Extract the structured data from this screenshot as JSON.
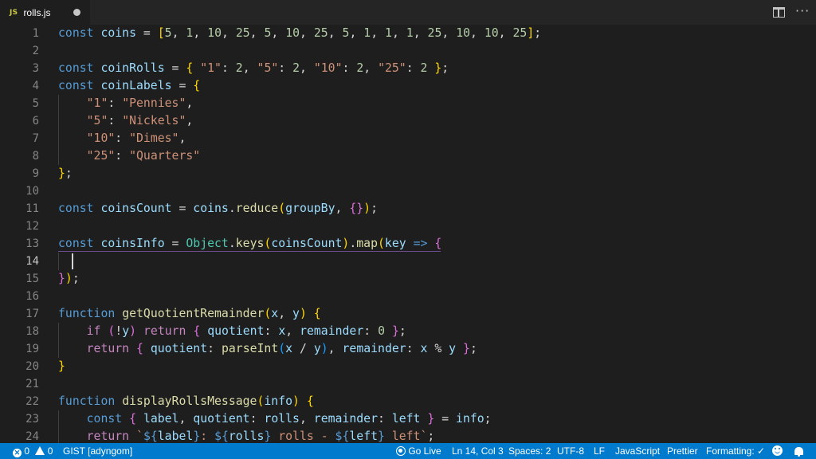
{
  "tab": {
    "icon": "JS",
    "filename": "rolls.js"
  },
  "code_lines": [
    [
      [
        "k",
        "const "
      ],
      [
        "v",
        "coins"
      ],
      [
        "o",
        " = "
      ],
      [
        "b1",
        "["
      ],
      [
        "n",
        "5"
      ],
      [
        "o",
        ", "
      ],
      [
        "n",
        "1"
      ],
      [
        "o",
        ", "
      ],
      [
        "n",
        "10"
      ],
      [
        "o",
        ", "
      ],
      [
        "n",
        "25"
      ],
      [
        "o",
        ", "
      ],
      [
        "n",
        "5"
      ],
      [
        "o",
        ", "
      ],
      [
        "n",
        "10"
      ],
      [
        "o",
        ", "
      ],
      [
        "n",
        "25"
      ],
      [
        "o",
        ", "
      ],
      [
        "n",
        "5"
      ],
      [
        "o",
        ", "
      ],
      [
        "n",
        "1"
      ],
      [
        "o",
        ", "
      ],
      [
        "n",
        "1"
      ],
      [
        "o",
        ", "
      ],
      [
        "n",
        "1"
      ],
      [
        "o",
        ", "
      ],
      [
        "n",
        "25"
      ],
      [
        "o",
        ", "
      ],
      [
        "n",
        "10"
      ],
      [
        "o",
        ", "
      ],
      [
        "n",
        "10"
      ],
      [
        "o",
        ", "
      ],
      [
        "n",
        "25"
      ],
      [
        "b1",
        "]"
      ],
      [
        "o",
        ";"
      ]
    ],
    [],
    [
      [
        "k",
        "const "
      ],
      [
        "v",
        "coinRolls"
      ],
      [
        "o",
        " = "
      ],
      [
        "b1",
        "{"
      ],
      [
        "o",
        " "
      ],
      [
        "s",
        "\"1\""
      ],
      [
        "o",
        ": "
      ],
      [
        "n",
        "2"
      ],
      [
        "o",
        ", "
      ],
      [
        "s",
        "\"5\""
      ],
      [
        "o",
        ": "
      ],
      [
        "n",
        "2"
      ],
      [
        "o",
        ", "
      ],
      [
        "s",
        "\"10\""
      ],
      [
        "o",
        ": "
      ],
      [
        "n",
        "2"
      ],
      [
        "o",
        ", "
      ],
      [
        "s",
        "\"25\""
      ],
      [
        "o",
        ": "
      ],
      [
        "n",
        "2"
      ],
      [
        "o",
        " "
      ],
      [
        "b1",
        "}"
      ],
      [
        "o",
        ";"
      ]
    ],
    [
      [
        "k",
        "const "
      ],
      [
        "v",
        "coinLabels"
      ],
      [
        "o",
        " = "
      ],
      [
        "b1",
        "{"
      ]
    ],
    [
      [
        "o",
        "    "
      ],
      [
        "s",
        "\"1\""
      ],
      [
        "o",
        ": "
      ],
      [
        "s",
        "\"Pennies\""
      ],
      [
        "o",
        ","
      ]
    ],
    [
      [
        "o",
        "    "
      ],
      [
        "s",
        "\"5\""
      ],
      [
        "o",
        ": "
      ],
      [
        "s",
        "\"Nickels\""
      ],
      [
        "o",
        ","
      ]
    ],
    [
      [
        "o",
        "    "
      ],
      [
        "s",
        "\"10\""
      ],
      [
        "o",
        ": "
      ],
      [
        "s",
        "\"Dimes\""
      ],
      [
        "o",
        ","
      ]
    ],
    [
      [
        "o",
        "    "
      ],
      [
        "s",
        "\"25\""
      ],
      [
        "o",
        ": "
      ],
      [
        "s",
        "\"Quarters\""
      ]
    ],
    [
      [
        "b1",
        "}"
      ],
      [
        "o",
        ";"
      ]
    ],
    [],
    [
      [
        "k",
        "const "
      ],
      [
        "v",
        "coinsCount"
      ],
      [
        "o",
        " = "
      ],
      [
        "v",
        "coins"
      ],
      [
        "o",
        "."
      ],
      [
        "f",
        "reduce"
      ],
      [
        "b1",
        "("
      ],
      [
        "v",
        "groupBy"
      ],
      [
        "o",
        ", "
      ],
      [
        "b2",
        "{}"
      ],
      [
        "b1",
        ")"
      ],
      [
        "o",
        ";"
      ]
    ],
    [],
    [
      [
        "k",
        "const "
      ],
      [
        "v",
        "coinsInfo"
      ],
      [
        "o",
        " = "
      ],
      [
        "c",
        "Object"
      ],
      [
        "o",
        "."
      ],
      [
        "f",
        "keys"
      ],
      [
        "b1",
        "("
      ],
      [
        "v",
        "coinsCount"
      ],
      [
        "b1",
        ")"
      ],
      [
        "o",
        "."
      ],
      [
        "f",
        "map"
      ],
      [
        "b1",
        "("
      ],
      [
        "v",
        "key"
      ],
      [
        "o",
        " "
      ],
      [
        "k",
        "=>"
      ],
      [
        "o",
        " "
      ],
      [
        "b2",
        "{"
      ]
    ],
    [],
    [
      [
        "b2",
        "}"
      ],
      [
        "b1",
        ")"
      ],
      [
        "o",
        ";"
      ]
    ],
    [],
    [
      [
        "k",
        "function "
      ],
      [
        "f",
        "getQuotientRemainder"
      ],
      [
        "b1",
        "("
      ],
      [
        "v",
        "x"
      ],
      [
        "o",
        ", "
      ],
      [
        "v",
        "y"
      ],
      [
        "b1",
        ")"
      ],
      [
        "o",
        " "
      ],
      [
        "b1",
        "{"
      ]
    ],
    [
      [
        "o",
        "    "
      ],
      [
        "p",
        "if"
      ],
      [
        "o",
        " "
      ],
      [
        "b2",
        "("
      ],
      [
        "o",
        "!"
      ],
      [
        "v",
        "y"
      ],
      [
        "b2",
        ")"
      ],
      [
        "o",
        " "
      ],
      [
        "p",
        "return"
      ],
      [
        "o",
        " "
      ],
      [
        "b2",
        "{"
      ],
      [
        "o",
        " "
      ],
      [
        "v",
        "quotient"
      ],
      [
        "o",
        ": "
      ],
      [
        "v",
        "x"
      ],
      [
        "o",
        ", "
      ],
      [
        "v",
        "remainder"
      ],
      [
        "o",
        ": "
      ],
      [
        "n",
        "0"
      ],
      [
        "o",
        " "
      ],
      [
        "b2",
        "}"
      ],
      [
        "o",
        ";"
      ]
    ],
    [
      [
        "o",
        "    "
      ],
      [
        "p",
        "return"
      ],
      [
        "o",
        " "
      ],
      [
        "b2",
        "{"
      ],
      [
        "o",
        " "
      ],
      [
        "v",
        "quotient"
      ],
      [
        "o",
        ": "
      ],
      [
        "f",
        "parseInt"
      ],
      [
        "b3",
        "("
      ],
      [
        "v",
        "x"
      ],
      [
        "o",
        " / "
      ],
      [
        "v",
        "y"
      ],
      [
        "b3",
        ")"
      ],
      [
        "o",
        ", "
      ],
      [
        "v",
        "remainder"
      ],
      [
        "o",
        ": "
      ],
      [
        "v",
        "x"
      ],
      [
        "o",
        " % "
      ],
      [
        "v",
        "y"
      ],
      [
        "o",
        " "
      ],
      [
        "b2",
        "}"
      ],
      [
        "o",
        ";"
      ]
    ],
    [
      [
        "b1",
        "}"
      ]
    ],
    [],
    [
      [
        "k",
        "function "
      ],
      [
        "f",
        "displayRollsMessage"
      ],
      [
        "b1",
        "("
      ],
      [
        "v",
        "info"
      ],
      [
        "b1",
        ")"
      ],
      [
        "o",
        " "
      ],
      [
        "b1",
        "{"
      ]
    ],
    [
      [
        "o",
        "    "
      ],
      [
        "k",
        "const "
      ],
      [
        "b2",
        "{"
      ],
      [
        "o",
        " "
      ],
      [
        "v",
        "label"
      ],
      [
        "o",
        ", "
      ],
      [
        "v",
        "quotient"
      ],
      [
        "o",
        ": "
      ],
      [
        "v",
        "rolls"
      ],
      [
        "o",
        ", "
      ],
      [
        "v",
        "remainder"
      ],
      [
        "o",
        ": "
      ],
      [
        "v",
        "left"
      ],
      [
        "o",
        " "
      ],
      [
        "b2",
        "}"
      ],
      [
        "o",
        " = "
      ],
      [
        "v",
        "info"
      ],
      [
        "o",
        ";"
      ]
    ],
    [
      [
        "o",
        "    "
      ],
      [
        "p",
        "return"
      ],
      [
        "o",
        " "
      ],
      [
        "s",
        "`"
      ],
      [
        "k",
        "${"
      ],
      [
        "v",
        "label"
      ],
      [
        "k",
        "}"
      ],
      [
        "s",
        ": "
      ],
      [
        "k",
        "${"
      ],
      [
        "v",
        "rolls"
      ],
      [
        "k",
        "}"
      ],
      [
        "s",
        " rolls - "
      ],
      [
        "k",
        "${"
      ],
      [
        "v",
        "left"
      ],
      [
        "k",
        "}"
      ],
      [
        "s",
        " left`"
      ],
      [
        "o",
        ";"
      ]
    ]
  ],
  "active_line": 14,
  "status": {
    "errors": "0",
    "warnings": "0",
    "gist": "GIST [adyngom]",
    "go_live": "Go Live",
    "position": "Ln 14, Col 3",
    "spaces": "Spaces: 2",
    "encoding": "UTF-8",
    "eol": "LF",
    "language": "JavaScript",
    "prettier": "Prettier",
    "formatting": "Formatting: ✓"
  },
  "colors": {
    "statusbar": "#007acc",
    "editor_bg": "#1e1e1e",
    "tab_bar": "#252526"
  }
}
